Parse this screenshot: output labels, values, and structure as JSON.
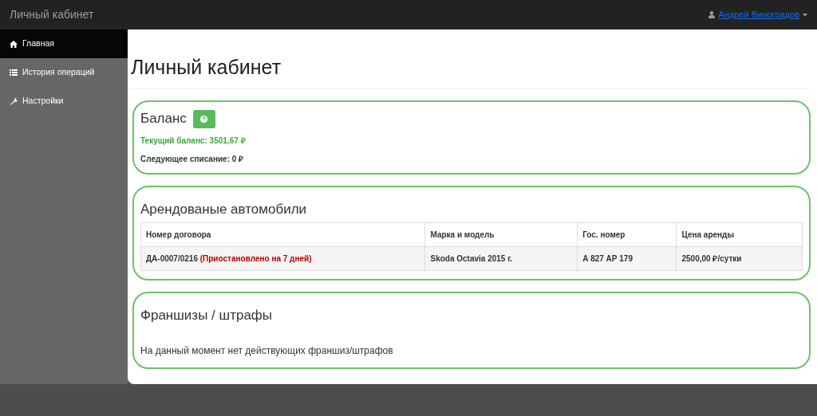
{
  "navbar": {
    "brand": "Личный кабинет",
    "user": "Андрей Виноградов"
  },
  "sidebar": {
    "items": [
      {
        "label": "Главная",
        "selected": true
      },
      {
        "label": "История операций",
        "selected": false
      },
      {
        "label": "Настройки",
        "selected": false
      }
    ]
  },
  "page_title": "Личный кабинет",
  "balance": {
    "title": "Баланс",
    "current": "Текущий баланс: 3501,67 ₽",
    "next": "Следующее списание: 0 ₽"
  },
  "cars": {
    "title": "Арендованые автомобили",
    "columns": [
      "Номер договора",
      "Марка и модель",
      "Гос. номер",
      "Цена аренды"
    ],
    "rows": [
      {
        "contract": "ДА-0007/0216",
        "status": "(Приостановлено на 7 дней)",
        "model": "Skoda Octavia 2015 г.",
        "plate": "А 827 АР 179",
        "price": "2500,00 ₽/сутки"
      }
    ]
  },
  "fines": {
    "title": "Франшизы / штрафы",
    "message": "На данный момент нет действующих франшиз/штрафов"
  }
}
